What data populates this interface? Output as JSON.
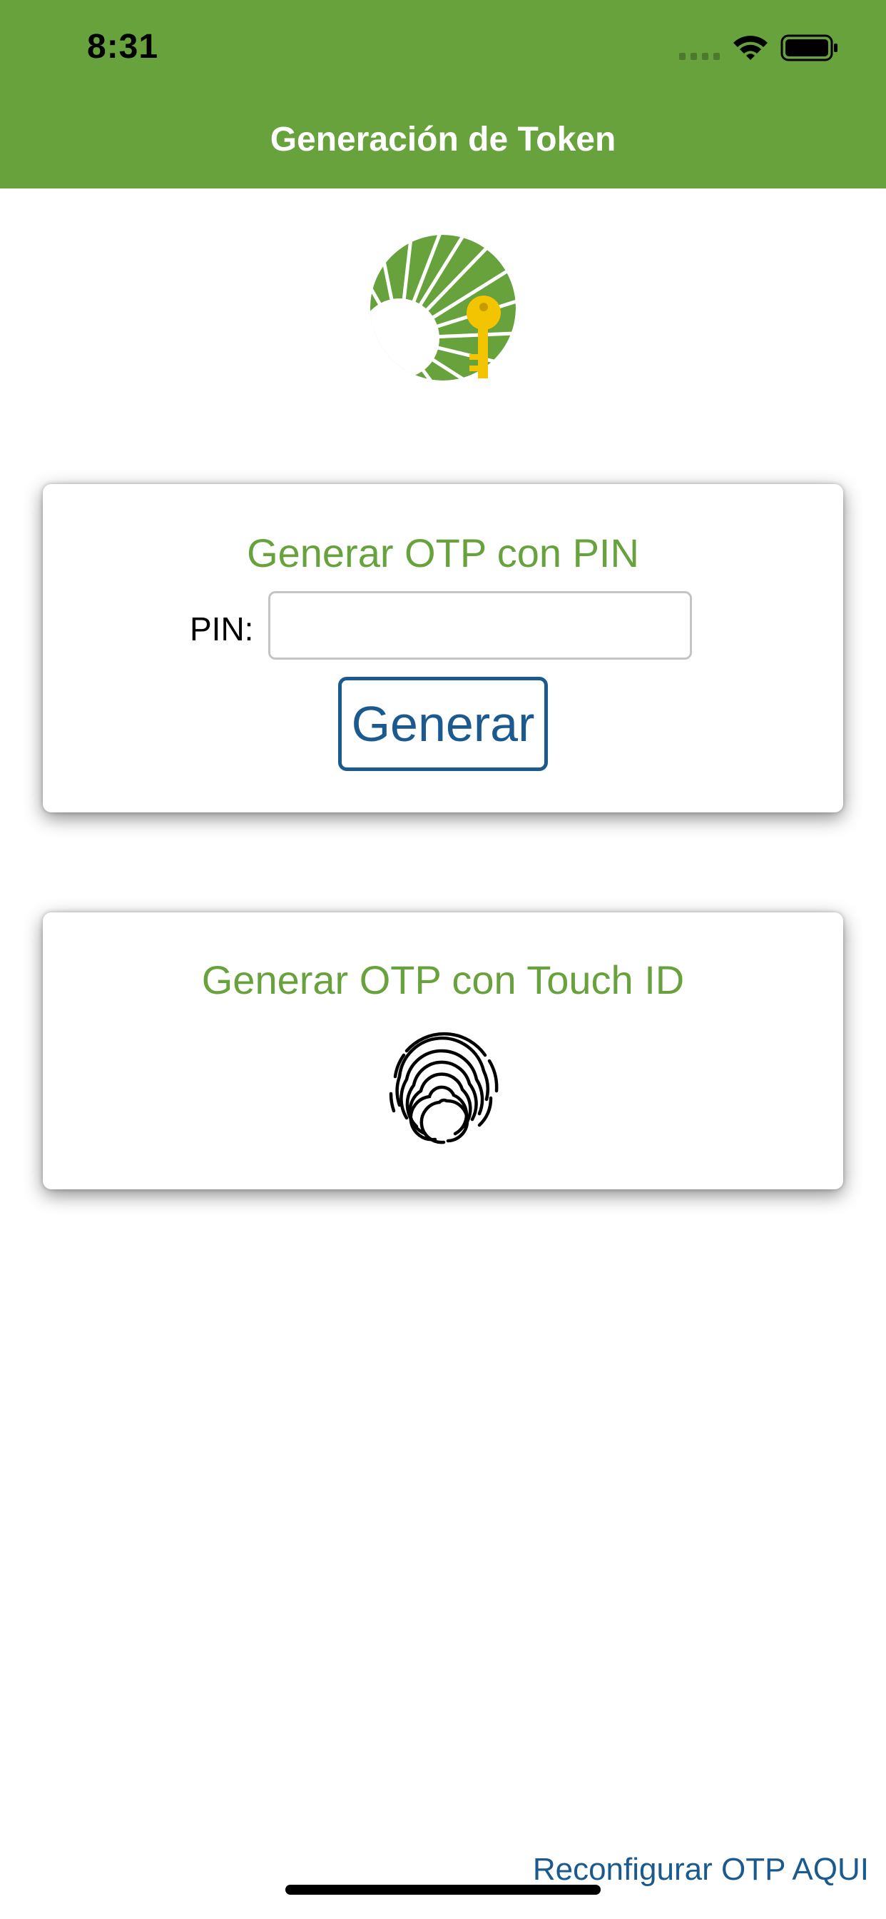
{
  "status_bar": {
    "time": "8:31",
    "signal_icon": "cellular-signal-icon",
    "wifi_icon": "wifi-icon",
    "battery_icon": "battery-icon"
  },
  "header": {
    "title": "Generación de Token",
    "background_color": "#67a23d"
  },
  "logo": {
    "icon": "sunburst-key-logo"
  },
  "pin_card": {
    "title": "Generar OTP con PIN",
    "pin_label": "PIN:",
    "pin_value": "",
    "pin_placeholder": "",
    "generate_label": "Generar"
  },
  "touch_card": {
    "title": "Generar OTP con Touch ID",
    "fingerprint_icon": "fingerprint-icon"
  },
  "footer": {
    "reconfigure_link": "Reconfigurar OTP AQUI"
  },
  "colors": {
    "accent_green": "#67a23d",
    "link_blue": "#1b5a8e",
    "key_yellow": "#f2c500"
  }
}
